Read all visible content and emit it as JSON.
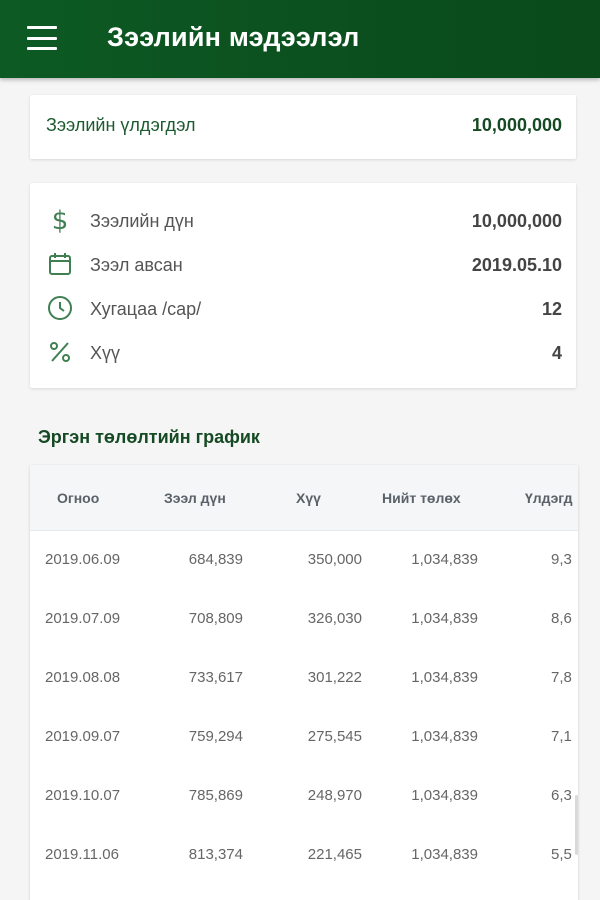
{
  "header": {
    "title": "Зээлийн мэдээлэл",
    "menu_icon": "hamburger-menu-icon"
  },
  "balance": {
    "label": "Зээлийн үлдэгдэл",
    "value": "10,000,000"
  },
  "details": [
    {
      "icon": "dollar-icon",
      "label": "Зээлийн дүн",
      "value": "10,000,000"
    },
    {
      "icon": "calendar-icon",
      "label": "Зээл авсан",
      "value": "2019.05.10"
    },
    {
      "icon": "clock-icon",
      "label": "Хугацаа /сар/",
      "value": "12"
    },
    {
      "icon": "percent-icon",
      "label": "Хүү",
      "value": "4"
    }
  ],
  "schedule": {
    "title": "Эргэн төлөлтийн график",
    "columns": [
      "Огноо",
      "Зээл дүн",
      "Хүү",
      "Нийт төлөх",
      "Үлдэгд"
    ],
    "rows": [
      [
        "2019.06.09",
        "684,839",
        "350,000",
        "1,034,839",
        "9,3"
      ],
      [
        "2019.07.09",
        "708,809",
        "326,030",
        "1,034,839",
        "8,6"
      ],
      [
        "2019.08.08",
        "733,617",
        "301,222",
        "1,034,839",
        "7,8"
      ],
      [
        "2019.09.07",
        "759,294",
        "275,545",
        "1,034,839",
        "7,1"
      ],
      [
        "2019.10.07",
        "785,869",
        "248,970",
        "1,034,839",
        "6,3"
      ],
      [
        "2019.11.06",
        "813,374",
        "221,465",
        "1,034,839",
        "5,5"
      ]
    ]
  },
  "colors": {
    "appbar": "#0d5a24",
    "accent": "#154a24",
    "icon": "#3f7f52"
  }
}
